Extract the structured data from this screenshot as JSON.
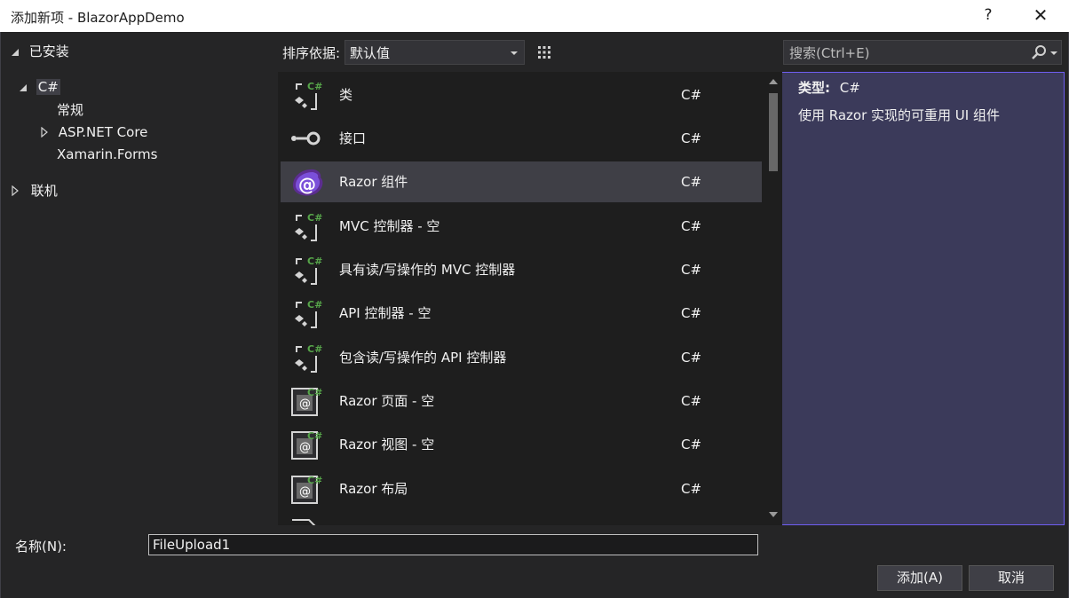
{
  "window": {
    "title": "添加新项 - BlazorAppDemo",
    "help": "?",
    "close": "✕"
  },
  "tree": {
    "installed": "已安装",
    "csharp": "C#",
    "general": "常规",
    "aspnetcore": "ASP.NET Core",
    "xamarin": "Xamarin.Forms",
    "online": "联机"
  },
  "toolbar": {
    "sort_label": "排序依据:",
    "sort_value": "默认值",
    "search_placeholder": "搜索(Ctrl+E)"
  },
  "items": [
    {
      "name": "类",
      "lang": "C#",
      "icon": "class-icon"
    },
    {
      "name": "接口",
      "lang": "C#",
      "icon": "interface-icon"
    },
    {
      "name": "Razor 组件",
      "lang": "C#",
      "icon": "blazor-icon",
      "selected": true
    },
    {
      "name": "MVC 控制器 - 空",
      "lang": "C#",
      "icon": "class-icon"
    },
    {
      "name": "具有读/写操作的 MVC 控制器",
      "lang": "C#",
      "icon": "class-icon"
    },
    {
      "name": "API 控制器 - 空",
      "lang": "C#",
      "icon": "class-icon"
    },
    {
      "name": "包含读/写操作的 API 控制器",
      "lang": "C#",
      "icon": "class-icon"
    },
    {
      "name": "Razor 页面 - 空",
      "lang": "C#",
      "icon": "razor-file-icon"
    },
    {
      "name": "Razor 视图 - 空",
      "lang": "C#",
      "icon": "razor-file-icon"
    },
    {
      "name": "Razor 布局",
      "lang": "C#",
      "icon": "razor-file-icon"
    }
  ],
  "details": {
    "type_key": "类型:",
    "type_value": "C#",
    "description": "使用 Razor 实现的可重用 UI 组件"
  },
  "bottom": {
    "name_label": "名称(N):",
    "name_value": "FileUpload1",
    "add": "添加(A)",
    "cancel": "取消"
  },
  "colors": {
    "accent": "#6f5ef2",
    "csharp_badge": "#57a64a",
    "blazor": "#5c2d91"
  }
}
